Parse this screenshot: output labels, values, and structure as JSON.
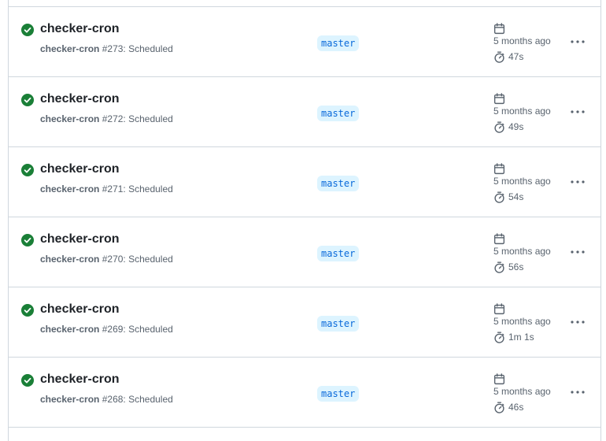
{
  "colors": {
    "success": "#1a7f37",
    "branch_bg": "#ddf4ff",
    "branch_fg": "#0969da",
    "muted": "#59636e",
    "border": "#d0d7de"
  },
  "icons": {
    "status": "check-circle-fill-icon",
    "calendar": "calendar-icon",
    "duration": "stopwatch-icon",
    "more": "kebab-horizontal-icon"
  },
  "runs": [
    {
      "title": "checker-cron",
      "workflow": "checker-cron",
      "run_number": "#273",
      "event": ": Scheduled",
      "branch": "master",
      "date": "5 months ago",
      "duration": "47s"
    },
    {
      "title": "checker-cron",
      "workflow": "checker-cron",
      "run_number": "#272",
      "event": ": Scheduled",
      "branch": "master",
      "date": "5 months ago",
      "duration": "49s"
    },
    {
      "title": "checker-cron",
      "workflow": "checker-cron",
      "run_number": "#271",
      "event": ": Scheduled",
      "branch": "master",
      "date": "5 months ago",
      "duration": "54s"
    },
    {
      "title": "checker-cron",
      "workflow": "checker-cron",
      "run_number": "#270",
      "event": ": Scheduled",
      "branch": "master",
      "date": "5 months ago",
      "duration": "56s"
    },
    {
      "title": "checker-cron",
      "workflow": "checker-cron",
      "run_number": "#269",
      "event": ": Scheduled",
      "branch": "master",
      "date": "5 months ago",
      "duration": "1m 1s"
    },
    {
      "title": "checker-cron",
      "workflow": "checker-cron",
      "run_number": "#268",
      "event": ": Scheduled",
      "branch": "master",
      "date": "5 months ago",
      "duration": "46s"
    }
  ]
}
